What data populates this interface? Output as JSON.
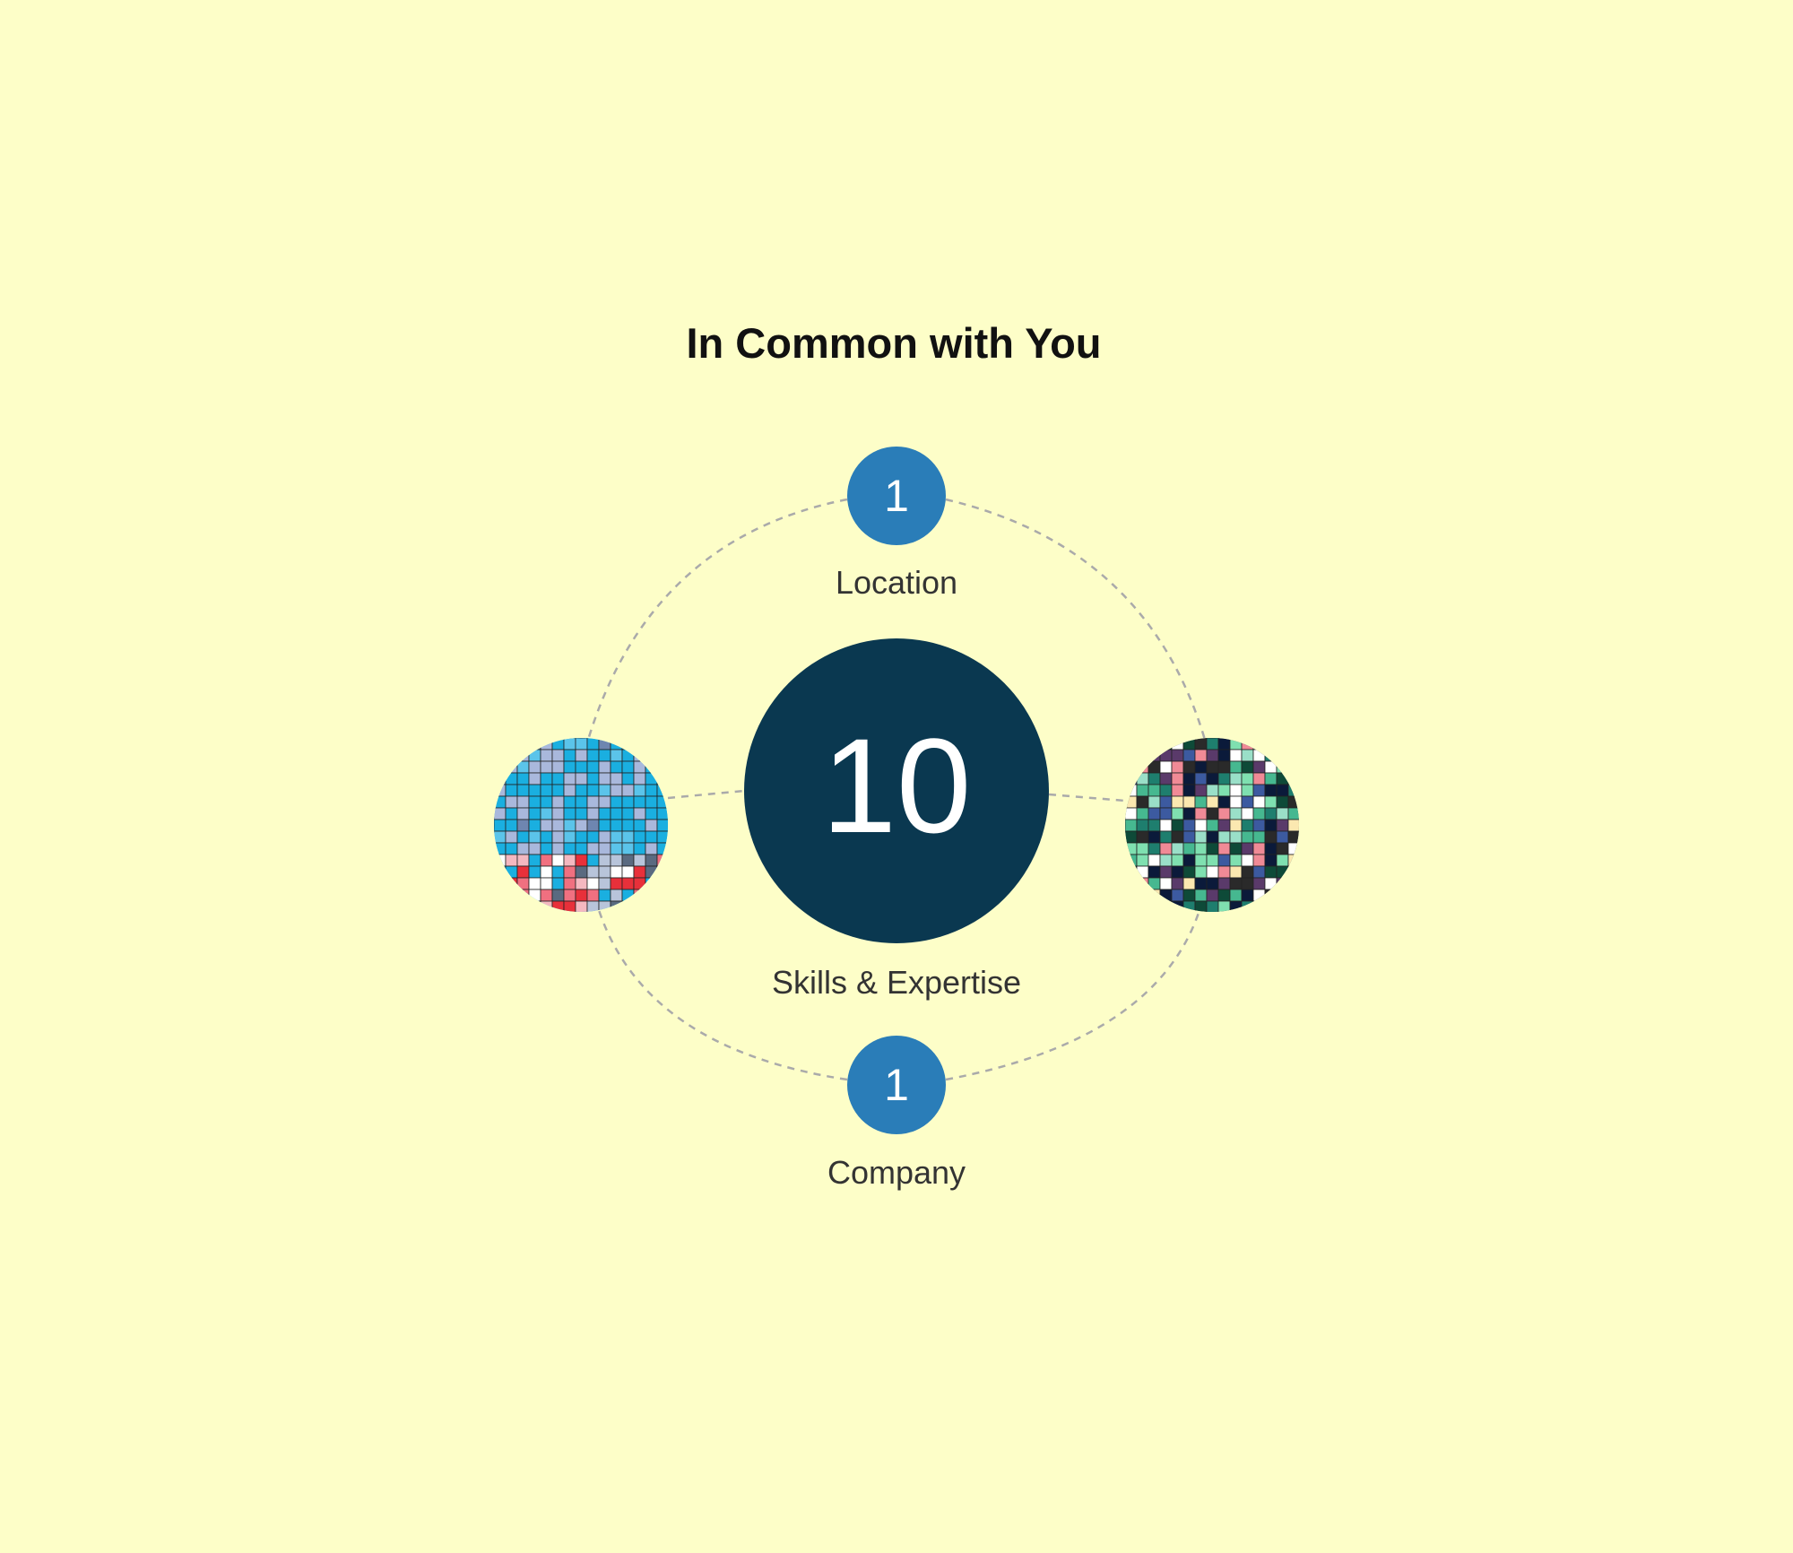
{
  "title": "In Common with You",
  "colors": {
    "background": "#FDFEC8",
    "center_node": "#0A3850",
    "small_node": "#2A7DB8",
    "orbit": "#AAAAAA"
  },
  "center": {
    "count": "10",
    "label": "Skills & Expertise"
  },
  "top": {
    "count": "1",
    "label": "Location"
  },
  "bottom": {
    "count": "1",
    "label": "Company"
  },
  "left_avatar": {
    "icon": "pixel-avatar-icon"
  },
  "right_avatar": {
    "icon": "pixel-avatar-icon"
  }
}
